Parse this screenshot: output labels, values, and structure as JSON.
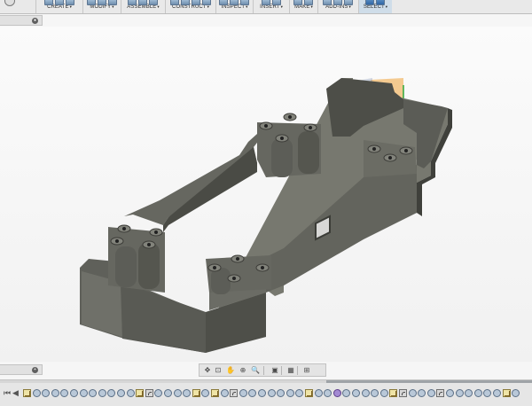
{
  "toolbar": {
    "groups": [
      {
        "label": "CREATE",
        "active": false
      },
      {
        "label": "MODIFY",
        "active": false
      },
      {
        "label": "ASSEMBLE",
        "active": false
      },
      {
        "label": "CONSTRUCT",
        "active": false
      },
      {
        "label": "INSPECT",
        "active": false
      },
      {
        "label": "INSERT",
        "active": false
      },
      {
        "label": "MAKE",
        "active": false
      },
      {
        "label": "ADD-INS",
        "active": false
      },
      {
        "label": "SELECT",
        "active": true
      }
    ],
    "dropdown_arrow": "▾"
  },
  "browser_panel": {
    "toggle_icon": "circle-dot-icon"
  },
  "comments_panel": {
    "toggle_icon": "plus-circle-icon"
  },
  "navigation_bar": {
    "tools": [
      {
        "name": "orbit-icon",
        "glyph": "✥"
      },
      {
        "name": "look-at-icon",
        "glyph": "⊡"
      },
      {
        "name": "pan-icon",
        "glyph": "✋"
      },
      {
        "name": "zoom-icon",
        "glyph": "⊕"
      },
      {
        "name": "zoom-window-icon",
        "glyph": "🔍"
      },
      {
        "name": "display-settings-icon",
        "glyph": "▣"
      },
      {
        "name": "grid-settings-icon",
        "glyph": "▦"
      },
      {
        "name": "viewports-icon",
        "glyph": "⊞"
      }
    ]
  },
  "viewport": {
    "model_color": "#5a5b55",
    "highlight_color": "#f0a43a",
    "background": "#f4f4f4"
  },
  "timeline": {
    "scroll_position": 0.61,
    "features": [
      "sketch",
      "extrude",
      "extrude",
      "extrude",
      "extrude",
      "extrude",
      "extrude",
      "extrude",
      "extrude",
      "extrude",
      "extrude",
      "extrude",
      "sketch",
      "fillet",
      "extrude",
      "extrude",
      "extrude",
      "extrude",
      "sketch",
      "extrude",
      "sketch",
      "extrude",
      "fillet",
      "extrude",
      "extrude",
      "extrude",
      "extrude",
      "extrude",
      "extrude",
      "extrude",
      "sketch",
      "extrude",
      "extrude",
      "body",
      "extrude",
      "extrude",
      "extrude",
      "extrude",
      "extrude",
      "sketch",
      "fillet",
      "extrude",
      "extrude",
      "extrude",
      "fillet",
      "extrude",
      "extrude",
      "extrude",
      "extrude",
      "extrude",
      "extrude",
      "sketch",
      "extrude"
    ]
  }
}
